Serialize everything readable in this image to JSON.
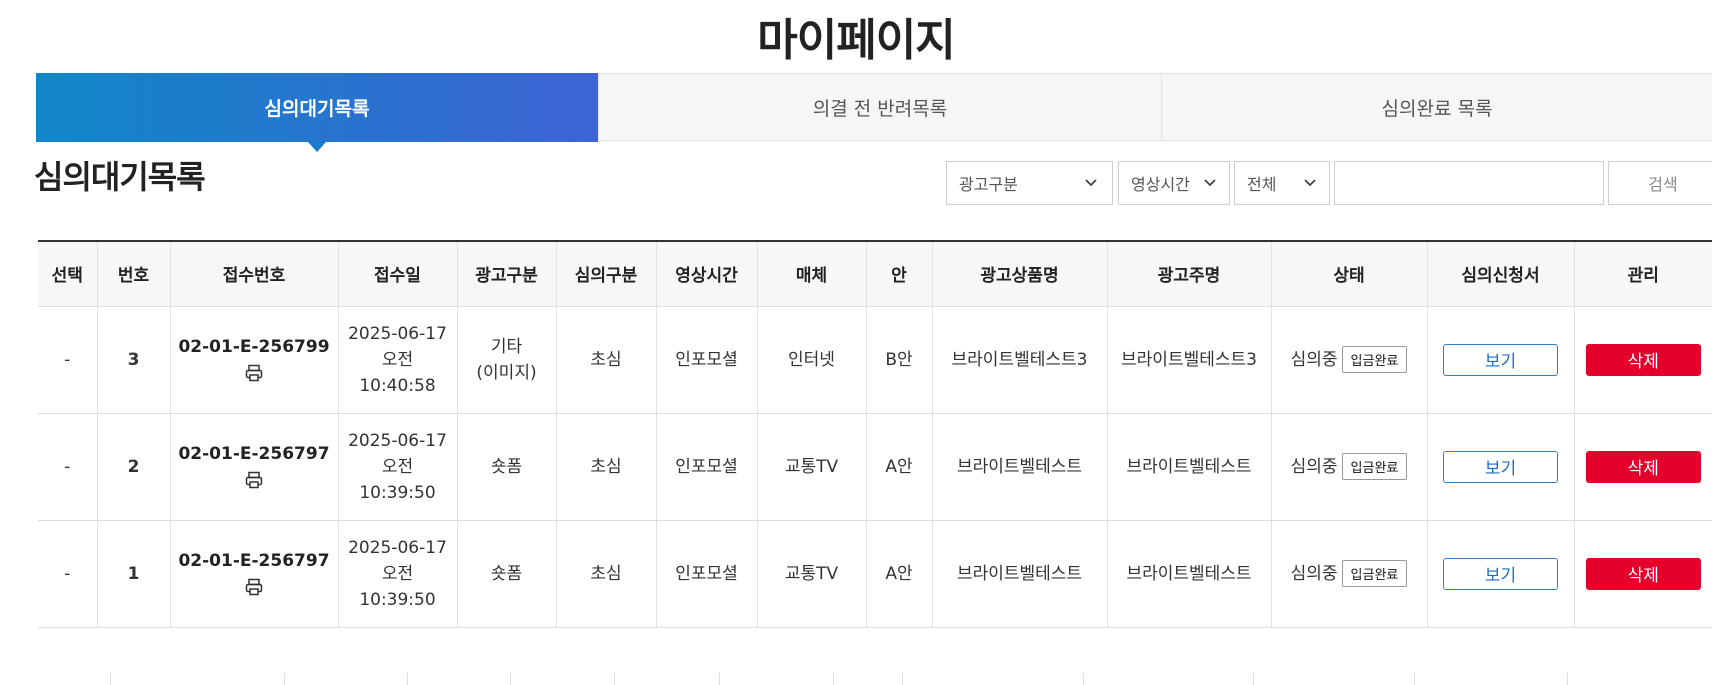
{
  "page": {
    "title": "마이페이지"
  },
  "tabs": [
    {
      "label": "심의대기목록",
      "active": true
    },
    {
      "label": "의결 전 반려목록",
      "active": false
    },
    {
      "label": "심의완료 목록",
      "active": false
    }
  ],
  "section": {
    "title": "심의대기목록"
  },
  "filters": {
    "ad_type": "광고구분",
    "video_time": "영상시간",
    "scope": "전체",
    "search_value": "",
    "search_label": "검색"
  },
  "table": {
    "headers": [
      "선택",
      "번호",
      "접수번호",
      "접수일",
      "광고구분",
      "심의구분",
      "영상시간",
      "매체",
      "안",
      "광고상품명",
      "광고주명",
      "상태",
      "심의신청서",
      "관리"
    ],
    "rows": [
      {
        "select": "-",
        "no": "3",
        "receipt_no": "02-01-E-256799",
        "date": "2025-06-17",
        "ampm": "오전",
        "time": "10:40:58",
        "ad_type_1": "기타",
        "ad_type_2": "(이미지)",
        "review_type": "초심",
        "video_time": "인포모셜",
        "media": "인터넷",
        "plan": "B안",
        "product": "브라이트벨테스트3",
        "advertiser": "브라이트벨테스트3",
        "status": "심의중",
        "deposit": "입금완료",
        "view": "보기",
        "delete": "삭제"
      },
      {
        "select": "-",
        "no": "2",
        "receipt_no": "02-01-E-256797",
        "date": "2025-06-17",
        "ampm": "오전",
        "time": "10:39:50",
        "ad_type_1": "숏폼",
        "ad_type_2": "",
        "review_type": "초심",
        "video_time": "인포모셜",
        "media": "교통TV",
        "plan": "A안",
        "product": "브라이트벨테스트",
        "advertiser": "브라이트벨테스트",
        "status": "심의중",
        "deposit": "입금완료",
        "view": "보기",
        "delete": "삭제"
      },
      {
        "select": "-",
        "no": "1",
        "receipt_no": "02-01-E-256797",
        "date": "2025-06-17",
        "ampm": "오전",
        "time": "10:39:50",
        "ad_type_1": "숏폼",
        "ad_type_2": "",
        "review_type": "초심",
        "video_time": "인포모셜",
        "media": "교통TV",
        "plan": "A안",
        "product": "브라이트벨테스트",
        "advertiser": "브라이트벨테스트",
        "status": "심의중",
        "deposit": "입금완료",
        "view": "보기",
        "delete": "삭제"
      }
    ]
  },
  "icons": {
    "print": "print-icon",
    "dropdown": "chevron-down-icon"
  },
  "colors": {
    "tab_gradient_start": "#1087c8",
    "tab_gradient_end": "#3d63d4",
    "delete_red": "#e4002b",
    "view_blue": "#1f6fbf"
  }
}
